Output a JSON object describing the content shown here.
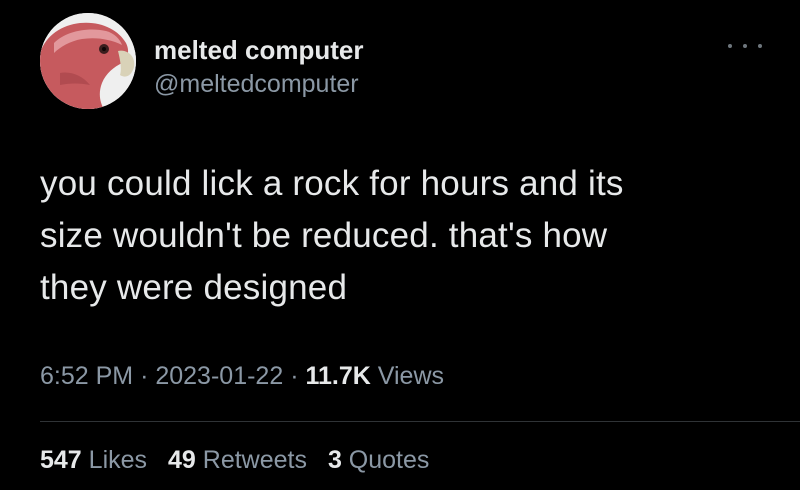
{
  "author": {
    "display_name": "melted computer",
    "handle": "@meltedcomputer",
    "avatar_icon": "parrot-avatar-icon"
  },
  "tweet": {
    "lines": [
      "you could lick a rock for hours and its",
      "size wouldn't be reduced. that's how",
      "they were designed"
    ]
  },
  "meta": {
    "time": "6:52 PM",
    "separator": "·",
    "date": "2023-01-22",
    "views_count": "11.7K",
    "views_label": "Views"
  },
  "stats": {
    "likes_count": "547",
    "likes_label": "Likes",
    "retweets_count": "49",
    "retweets_label": "Retweets",
    "quotes_count": "3",
    "quotes_label": "Quotes"
  },
  "colors": {
    "background": "#000000",
    "primary_text": "#e7e9ea",
    "secondary_text": "#8b98a5",
    "divider": "#2f3336"
  }
}
